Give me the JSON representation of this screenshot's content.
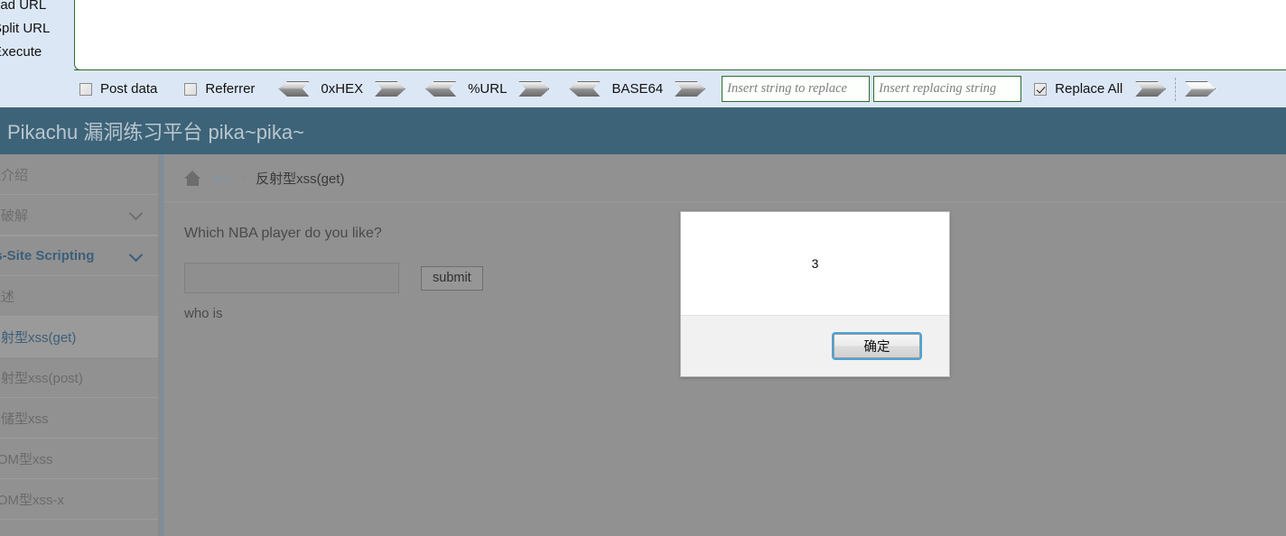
{
  "tool": {
    "buttons": [
      {
        "label": "oad URL",
        "name": "load-url-button"
      },
      {
        "label": "Split URL",
        "name": "split-url-button"
      },
      {
        "label": "Execute",
        "name": "execute-button"
      }
    ],
    "editor_value": "",
    "toolbar": {
      "post_data_label": "Post data",
      "post_data_checked": false,
      "referrer_label": "Referrer",
      "referrer_checked": false,
      "converters": [
        {
          "label": "0xHEX"
        },
        {
          "label": "%URL"
        },
        {
          "label": "BASE64"
        }
      ],
      "replace_find_placeholder": "Insert string to replace",
      "replace_find_value": "",
      "replace_with_placeholder": "Insert replacing string",
      "replace_with_value": "",
      "replace_all_label": "Replace All",
      "replace_all_checked": true
    }
  },
  "banner": {
    "title": "Pikachu 漏洞练习平台 pika~pika~"
  },
  "sidebar": {
    "items": [
      {
        "label": "统介绍",
        "type": "group",
        "chevron": false,
        "active": false
      },
      {
        "label": "力破解",
        "type": "group",
        "chevron": true,
        "active": false
      },
      {
        "label": "ss-Site Scripting",
        "type": "xss-group",
        "chevron": true,
        "active": false
      },
      {
        "label": "概述",
        "type": "sub",
        "chevron": false,
        "active": false
      },
      {
        "label": "反射型xss(get)",
        "type": "sub",
        "chevron": false,
        "active": true
      },
      {
        "label": "反射型xss(post)",
        "type": "sub",
        "chevron": false,
        "active": false
      },
      {
        "label": "存储型xss",
        "type": "sub",
        "chevron": false,
        "active": false
      },
      {
        "label": "DOM型xss",
        "type": "sub",
        "chevron": false,
        "active": false
      },
      {
        "label": "DOM型xss-x",
        "type": "sub",
        "chevron": false,
        "active": false
      }
    ]
  },
  "breadcrumb": {
    "home_icon": "home-icon",
    "link": "xss",
    "separator": ">",
    "current": "反射型xss(get)"
  },
  "main": {
    "question": "Which NBA player do you like?",
    "input_value": "",
    "submit_label": "submit",
    "result_text": "who is"
  },
  "dialog": {
    "message": "3",
    "ok_label": "确定"
  },
  "colors": {
    "banner_bg": "#3d6378",
    "toolbar_bg": "#dce7f6",
    "page_overlay": "#919191",
    "accent_blue": "#3c5f7a",
    "input_border_green": "#2f6b2f",
    "focus_ring": "#4aa3d8"
  }
}
